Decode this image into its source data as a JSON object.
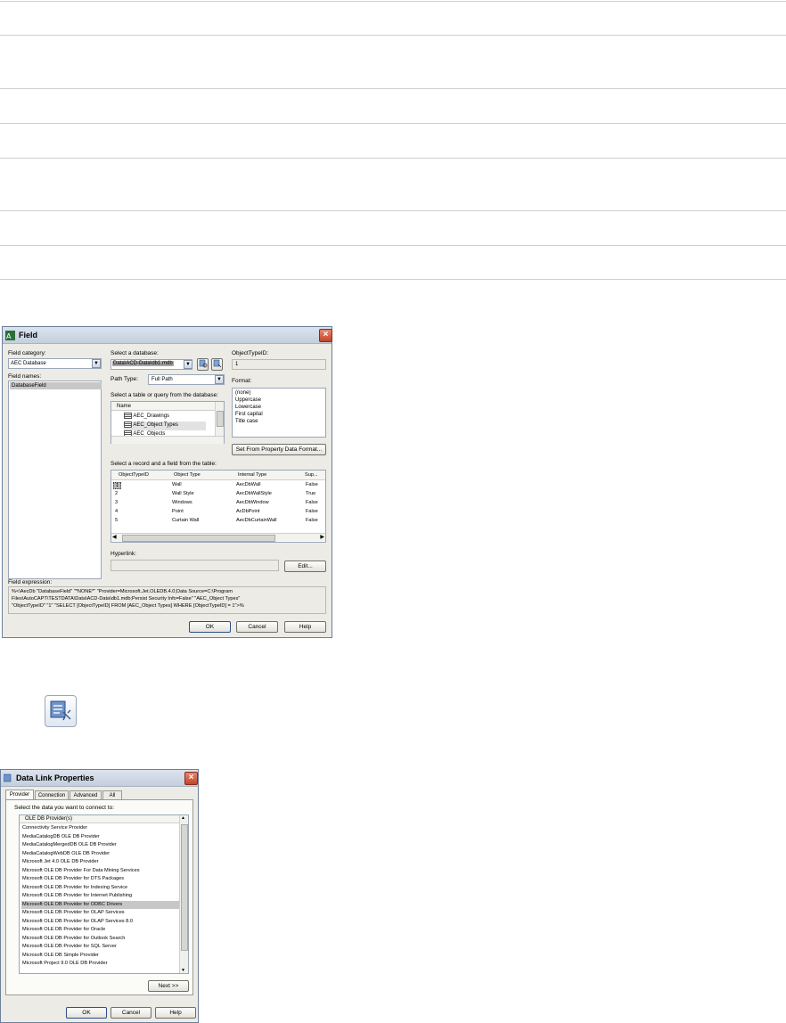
{
  "field_dialog": {
    "title": "Field",
    "field_category_label": "Field category:",
    "field_category_value": "AEC Database",
    "field_names_label": "Field names:",
    "field_names_selected": "DatabaseField",
    "select_database_label": "Select a database:",
    "database_value": "Data\\ACD-Data\\db1.mdb",
    "object_type_id_label": "ObjectTypeID:",
    "object_type_id_value": "1",
    "path_type_label": "Path Type:",
    "path_type_value": "Full Path",
    "format_label": "Format:",
    "format_options": [
      "(none)",
      "Uppercase",
      "Lowercase",
      "First capital",
      "Title case"
    ],
    "table_query_label": "Select a table or query from the database:",
    "table_list_header": "Name",
    "table_list_items": [
      "AEC_Drawings",
      "AEC_Object Types",
      "AEC_Objects"
    ],
    "set_from_property_button": "Set From Property Data Format...",
    "record_label": "Select a record and a field from the table:",
    "grid_headers": [
      "ObjectTypeID",
      "Object Type",
      "Internal Type",
      "Sup..."
    ],
    "grid_rows": [
      [
        "1",
        "Wall",
        "AecDbWall",
        "False"
      ],
      [
        "2",
        "Wall Style",
        "AecDbWallStyle",
        "True"
      ],
      [
        "3",
        "Windows",
        "AecDbWindow",
        "False"
      ],
      [
        "4",
        "Point",
        "AcDbPoint",
        "False"
      ],
      [
        "5",
        "Curtain Wall",
        "AecDbCurtainWall",
        "False"
      ]
    ],
    "hyperlink_label": "Hyperlink:",
    "edit_button": "Edit...",
    "field_expression_label": "Field expression:",
    "field_expression_lines": [
      "%<\\AecDb \"DatabaseField\" \"*NONE*\" \"Provider=Microsoft.Jet.OLEDB.4.0;Data Source=C:\\Program",
      "Files\\AutoCAPT\\TESTDATA\\Data\\ACD-Data\\db1.mdb;Persist Security Info=False\" \"AEC_Object Types\"",
      "\"ObjectTypeID\" \"1\" \"SELECT [ObjectTypeID] FROM [AEC_Object Types] WHERE [ObjectTypeID] = 1\">%"
    ],
    "ok_button": "OK",
    "cancel_button": "Cancel",
    "help_button": "Help"
  },
  "data_link_dialog": {
    "title": "Data Link Properties",
    "tabs": [
      "Provider",
      "Connection",
      "Advanced",
      "All"
    ],
    "instruction": "Select the data you want to connect to:",
    "list_header": "OLE DB Provider(s)",
    "providers": [
      "Connectivity Service Provider",
      "MediaCatalogDB OLE DB Provider",
      "MediaCatalogMergedDB OLE DB Provider",
      "MediaCatalogWebDB OLE DB Provider",
      "Microsoft Jet 4.0 OLE DB Provider",
      "Microsoft OLE DB Provider For Data Mining Services",
      "Microsoft OLE DB Provider for DTS Packages",
      "Microsoft OLE DB Provider for Indexing Service",
      "Microsoft OLE DB Provider for Internet Publishing",
      "Microsoft OLE DB Provider for ODBC Drivers",
      "Microsoft OLE DB Provider for OLAP Services",
      "Microsoft OLE DB Provider for OLAP Services 8.0",
      "Microsoft OLE DB Provider for Oracle",
      "Microsoft OLE DB Provider for Outlook Search",
      "Microsoft OLE DB Provider for SQL Server",
      "Microsoft OLE DB Simple Provider",
      "Microsoft Project 9.0 OLE DB Provider"
    ],
    "selected_provider_index": 9,
    "next_button": "Next >>",
    "ok_button": "OK",
    "cancel_button": "Cancel",
    "help_button": "Help"
  }
}
